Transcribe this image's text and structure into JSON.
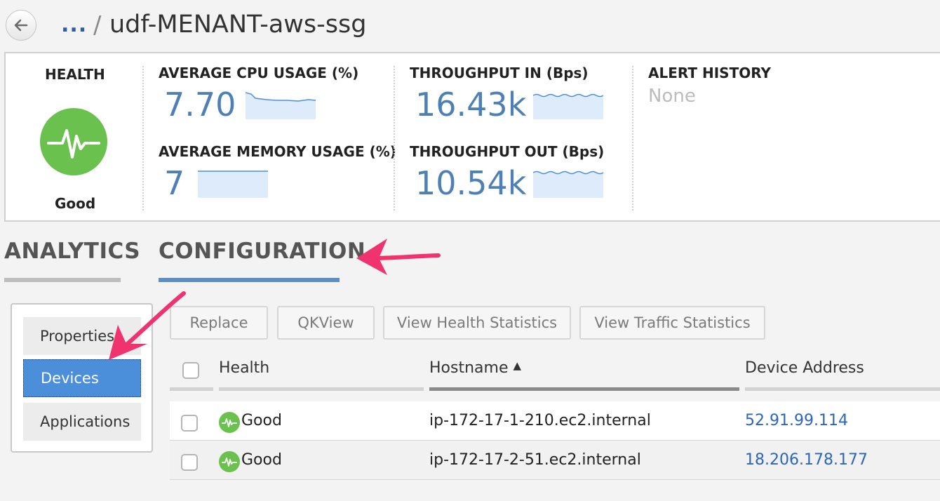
{
  "header": {
    "breadcrumb_ellipsis": "...",
    "separator": "/",
    "title": "udf-MENANT-aws-ssg"
  },
  "stats": {
    "health": {
      "label": "HEALTH",
      "status": "Good",
      "color": "#6bc14e"
    },
    "cpu": {
      "label": "AVERAGE CPU USAGE (%)",
      "value": "7.70"
    },
    "memory": {
      "label": "AVERAGE MEMORY USAGE (%)",
      "value": "7"
    },
    "throughput_in": {
      "label": "THROUGHPUT IN (Bps)",
      "value": "16.43k"
    },
    "throughput_out": {
      "label": "THROUGHPUT OUT (Bps)",
      "value": "10.54k"
    },
    "alert_history": {
      "label": "ALERT HISTORY",
      "value": "None"
    },
    "value_color": "#4c80b6"
  },
  "tabs": [
    {
      "label": "ANALYTICS",
      "active": false
    },
    {
      "label": "CONFIGURATION",
      "active": true
    }
  ],
  "side_menu": {
    "items": [
      {
        "label": "Properties",
        "active": false
      },
      {
        "label": "Devices",
        "active": true
      },
      {
        "label": "Applications",
        "active": false
      }
    ]
  },
  "toolbar": {
    "buttons": [
      "Replace",
      "QKView",
      "View Health Statistics",
      "View Traffic Statistics"
    ]
  },
  "table": {
    "columns": [
      "Health",
      "Hostname",
      "Device Address"
    ],
    "sort_indicator": "▲",
    "rows": [
      {
        "health": "Good",
        "hostname": "ip-172-17-1-210.ec2.internal",
        "address": "52.91.99.114"
      },
      {
        "health": "Good",
        "hostname": "ip-172-17-2-51.ec2.internal",
        "address": "18.206.178.177"
      }
    ]
  },
  "colors": {
    "accent": "#4b8fdb",
    "annotation_arrow": "#f0336f",
    "link": "#2c66b8"
  }
}
